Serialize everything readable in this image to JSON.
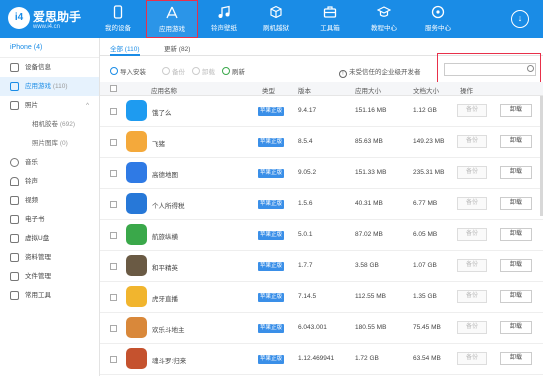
{
  "header": {
    "logo_text": "i4",
    "brand": "爱思助手",
    "url": "www.i4.cn",
    "nav": [
      {
        "label": "我的设备",
        "icon": "phone-icon"
      },
      {
        "label": "应用游戏",
        "icon": "apps-icon"
      },
      {
        "label": "铃声壁纸",
        "icon": "music-icon"
      },
      {
        "label": "刷机越狱",
        "icon": "box-icon"
      },
      {
        "label": "工具箱",
        "icon": "toolbox-icon"
      },
      {
        "label": "教程中心",
        "icon": "graduation-icon"
      },
      {
        "label": "服务中心",
        "icon": "service-icon"
      }
    ],
    "download_icon": "↓"
  },
  "sidebar": {
    "device": "iPhone (4)",
    "items": [
      {
        "label": "设备信息",
        "count": ""
      },
      {
        "label": "应用游戏",
        "count": "(110)"
      },
      {
        "label": "照片",
        "count": ""
      },
      {
        "label": "相机胶卷",
        "count": "(692)"
      },
      {
        "label": "照片图库",
        "count": "(0)"
      },
      {
        "label": "音乐",
        "count": ""
      },
      {
        "label": "铃声",
        "count": ""
      },
      {
        "label": "视频",
        "count": ""
      },
      {
        "label": "电子书",
        "count": ""
      },
      {
        "label": "虚拟U盘",
        "count": ""
      },
      {
        "label": "资料管理",
        "count": ""
      },
      {
        "label": "文件管理",
        "count": ""
      },
      {
        "label": "常用工具",
        "count": ""
      }
    ]
  },
  "tabs": [
    {
      "label": "全部 (110)"
    },
    {
      "label": "更新 (82)"
    }
  ],
  "toolbar": {
    "import_label": "导入安装",
    "backup_label": "备份",
    "uninstall_label": "卸载",
    "refresh_label": "刷新",
    "untrusted_label": "未受信任的企业级开发者",
    "search_placeholder": ""
  },
  "table": {
    "headers": [
      "应用名称",
      "类型",
      "版本",
      "应用大小",
      "文档大小",
      "操作"
    ],
    "rows": [
      {
        "name": "饿了么",
        "type": "苹果正版",
        "version": "9.4.17",
        "app_size": "151.16 MB",
        "doc_size": "1.12 GB",
        "color": "#1e9bf0"
      },
      {
        "name": "飞猪",
        "type": "苹果正版",
        "version": "8.5.4",
        "app_size": "85.63 MB",
        "doc_size": "149.23 MB",
        "color": "#f4a93b"
      },
      {
        "name": "高德地图",
        "type": "苹果正版",
        "version": "9.05.2",
        "app_size": "151.33 MB",
        "doc_size": "235.31 MB",
        "color": "#2f7ae5"
      },
      {
        "name": "个人所得税",
        "type": "苹果正版",
        "version": "1.5.6",
        "app_size": "40.31 MB",
        "doc_size": "6.77 MB",
        "color": "#2778d8"
      },
      {
        "name": "航旅纵横",
        "type": "苹果正版",
        "version": "5.0.1",
        "app_size": "87.02 MB",
        "doc_size": "6.05 MB",
        "color": "#3aa84a"
      },
      {
        "name": "和平精英",
        "type": "苹果正版",
        "version": "1.7.7",
        "app_size": "3.58 GB",
        "doc_size": "1.07 GB",
        "color": "#6a5a44"
      },
      {
        "name": "虎牙直播",
        "type": "苹果正版",
        "version": "7.14.5",
        "app_size": "112.55 MB",
        "doc_size": "1.35 GB",
        "color": "#f1b52e"
      },
      {
        "name": "欢乐斗地主",
        "type": "苹果正版",
        "version": "6.043.001",
        "app_size": "180.55 MB",
        "doc_size": "75.45 MB",
        "color": "#d9883a"
      },
      {
        "name": "魂斗罗:归来",
        "type": "苹果正版",
        "version": "1.12.469941",
        "app_size": "1.72 GB",
        "doc_size": "63.54 MB",
        "color": "#c5522e"
      }
    ],
    "action_backup": "备份",
    "action_uninstall": "卸载"
  }
}
